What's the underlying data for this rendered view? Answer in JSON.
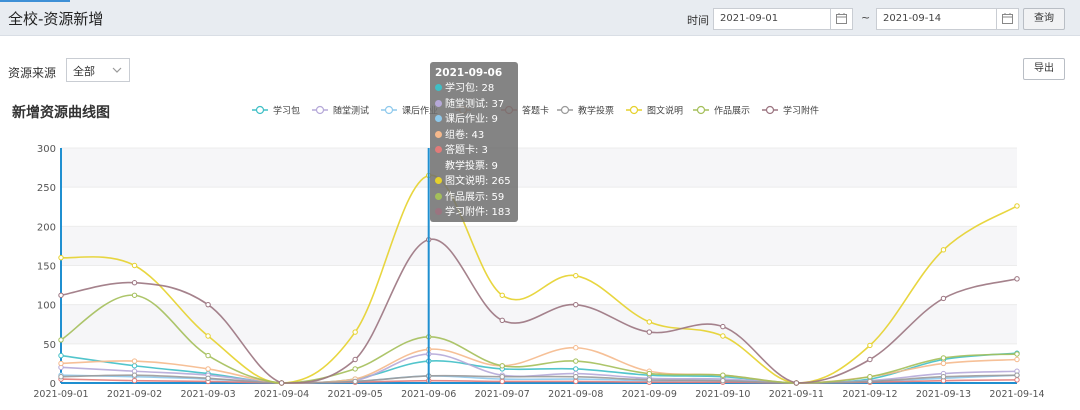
{
  "header": {
    "title": "全校-资源新增",
    "time_label": "时间",
    "start_date": "2021-09-01",
    "end_date": "2021-09-14",
    "range_sep": "~",
    "query_label": "查询"
  },
  "filters": {
    "source_label": "资源来源",
    "source_value": "全部"
  },
  "export_label": "导出",
  "colors": {
    "accent": "#3d8fd6",
    "cursor_line": "#1f8fd0"
  },
  "tooltip": {
    "date": "2021-09-06",
    "rows": [
      {
        "label": "学习包: 28",
        "color": "#3fbfc6"
      },
      {
        "label": "随堂测试: 37",
        "color": "#b5a8d8"
      },
      {
        "label": "课后作业: 9",
        "color": "#8ec9ec"
      },
      {
        "label": "组卷: 43",
        "color": "#f5b98c"
      },
      {
        "label": "答题卡: 3",
        "color": "#e27b79"
      },
      {
        "label": "教学投票: 9",
        "color": "#9a9a9a"
      },
      {
        "label": "图文说明: 265",
        "color": "#e6d12b"
      },
      {
        "label": "作品展示: 59",
        "color": "#a4bf5a"
      },
      {
        "label": "学习附件: 183",
        "color": "#9b7480"
      }
    ]
  },
  "chart_data": {
    "type": "line",
    "title": "新增资源曲线图",
    "x": [
      "2021-09-01",
      "2021-09-02",
      "2021-09-03",
      "2021-09-04",
      "2021-09-05",
      "2021-09-06",
      "2021-09-07",
      "2021-09-08",
      "2021-09-09",
      "2021-09-10",
      "2021-09-11",
      "2021-09-12",
      "2021-09-13",
      "2021-09-14"
    ],
    "ylim": [
      0,
      300
    ],
    "yticks": [
      0,
      50,
      100,
      150,
      200,
      250,
      300
    ],
    "legend_position": "top",
    "legend_visible": [
      "学习包",
      "随堂测试",
      "课后作业",
      "",
      "答题卡",
      "教学投票",
      "图文说明",
      "作品展示",
      "学习附件"
    ],
    "series": [
      {
        "name": "学习包",
        "color": "#3fbfc6",
        "values": [
          35,
          22,
          12,
          0,
          5,
          28,
          18,
          18,
          10,
          8,
          0,
          5,
          30,
          38
        ]
      },
      {
        "name": "随堂测试",
        "color": "#b5a8d8",
        "values": [
          20,
          15,
          10,
          0,
          3,
          37,
          10,
          12,
          6,
          5,
          0,
          3,
          12,
          15
        ]
      },
      {
        "name": "课后作业",
        "color": "#8ec9ec",
        "values": [
          10,
          8,
          5,
          0,
          2,
          9,
          5,
          5,
          3,
          3,
          0,
          2,
          6,
          10
        ]
      },
      {
        "name": "组卷",
        "color": "#f5b98c",
        "values": [
          25,
          28,
          18,
          0,
          5,
          43,
          22,
          45,
          15,
          10,
          0,
          8,
          25,
          30
        ]
      },
      {
        "name": "答题卡",
        "color": "#e27b79",
        "values": [
          5,
          3,
          2,
          0,
          1,
          3,
          2,
          2,
          1,
          1,
          0,
          1,
          3,
          4
        ]
      },
      {
        "name": "教学投票",
        "color": "#9a9a9a",
        "values": [
          8,
          10,
          6,
          0,
          2,
          9,
          8,
          8,
          4,
          3,
          0,
          2,
          8,
          10
        ]
      },
      {
        "name": "图文说明",
        "color": "#e6d12b",
        "values": [
          160,
          150,
          60,
          0,
          65,
          265,
          112,
          137,
          78,
          60,
          0,
          48,
          170,
          226
        ]
      },
      {
        "name": "作品展示",
        "color": "#a4bf5a",
        "values": [
          55,
          112,
          35,
          0,
          18,
          59,
          22,
          28,
          12,
          10,
          0,
          8,
          32,
          37
        ]
      },
      {
        "name": "学习附件",
        "color": "#9b7480",
        "values": [
          112,
          128,
          100,
          0,
          30,
          183,
          80,
          100,
          65,
          72,
          0,
          30,
          108,
          133
        ]
      }
    ]
  }
}
